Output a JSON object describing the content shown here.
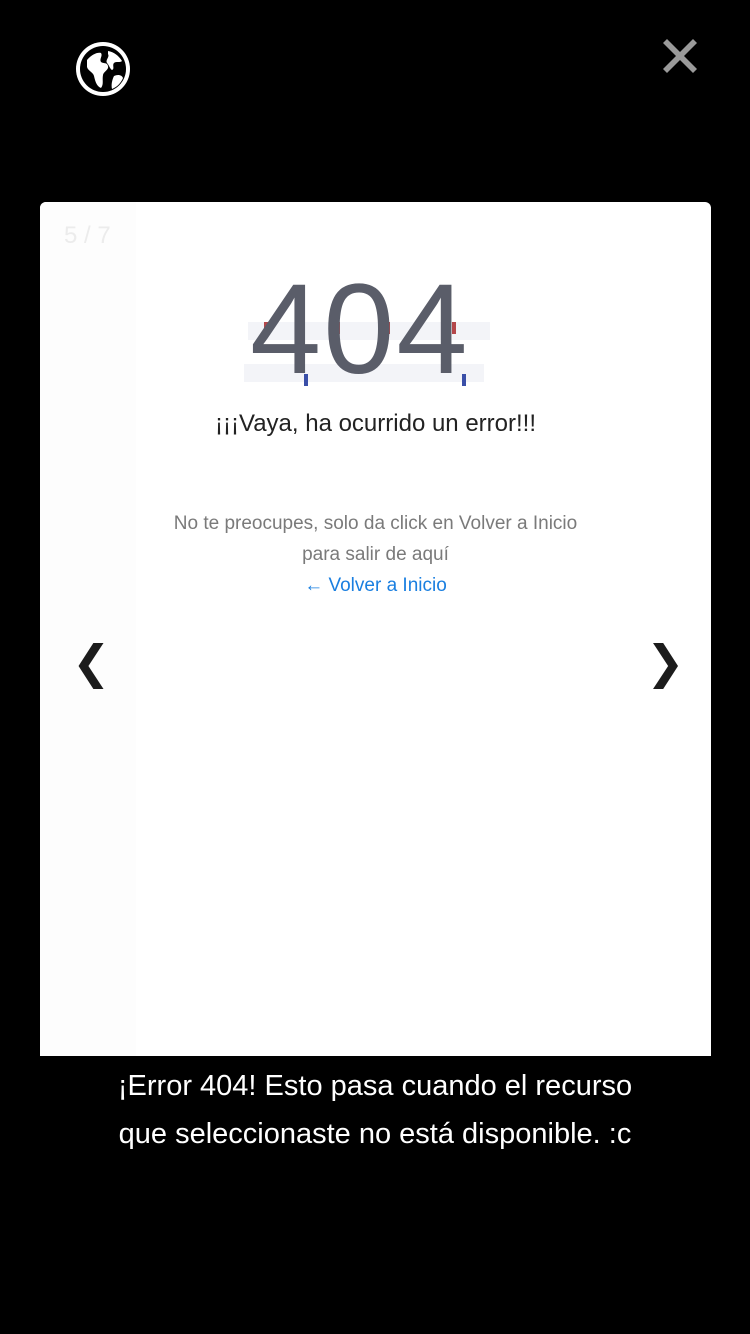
{
  "toolbar": {
    "globe_icon": "globe-icon",
    "close_icon": "close-icon"
  },
  "slide": {
    "counter": "5 / 7",
    "error_code": "404",
    "headline": "¡¡¡Vaya, ha ocurrido un error!!!",
    "subtext_line1": "No te preocupes, solo da click en Volver a Inicio",
    "subtext_line2": "para salir de aquí",
    "back_link": "← Volver a Inicio"
  },
  "nav": {
    "prev": "❮",
    "next": "❯"
  },
  "caption": {
    "line1": "¡Error 404! Esto pasa cuando el recurso",
    "line2": "que seleccionaste no está disponible. :c"
  },
  "colors": {
    "background": "#000000",
    "slide_bg": "#ffffff",
    "error_code": "#5a5d69",
    "link": "#1a7fe0",
    "subtext": "#7a7a7a",
    "close_icon": "#9a9a9a"
  }
}
